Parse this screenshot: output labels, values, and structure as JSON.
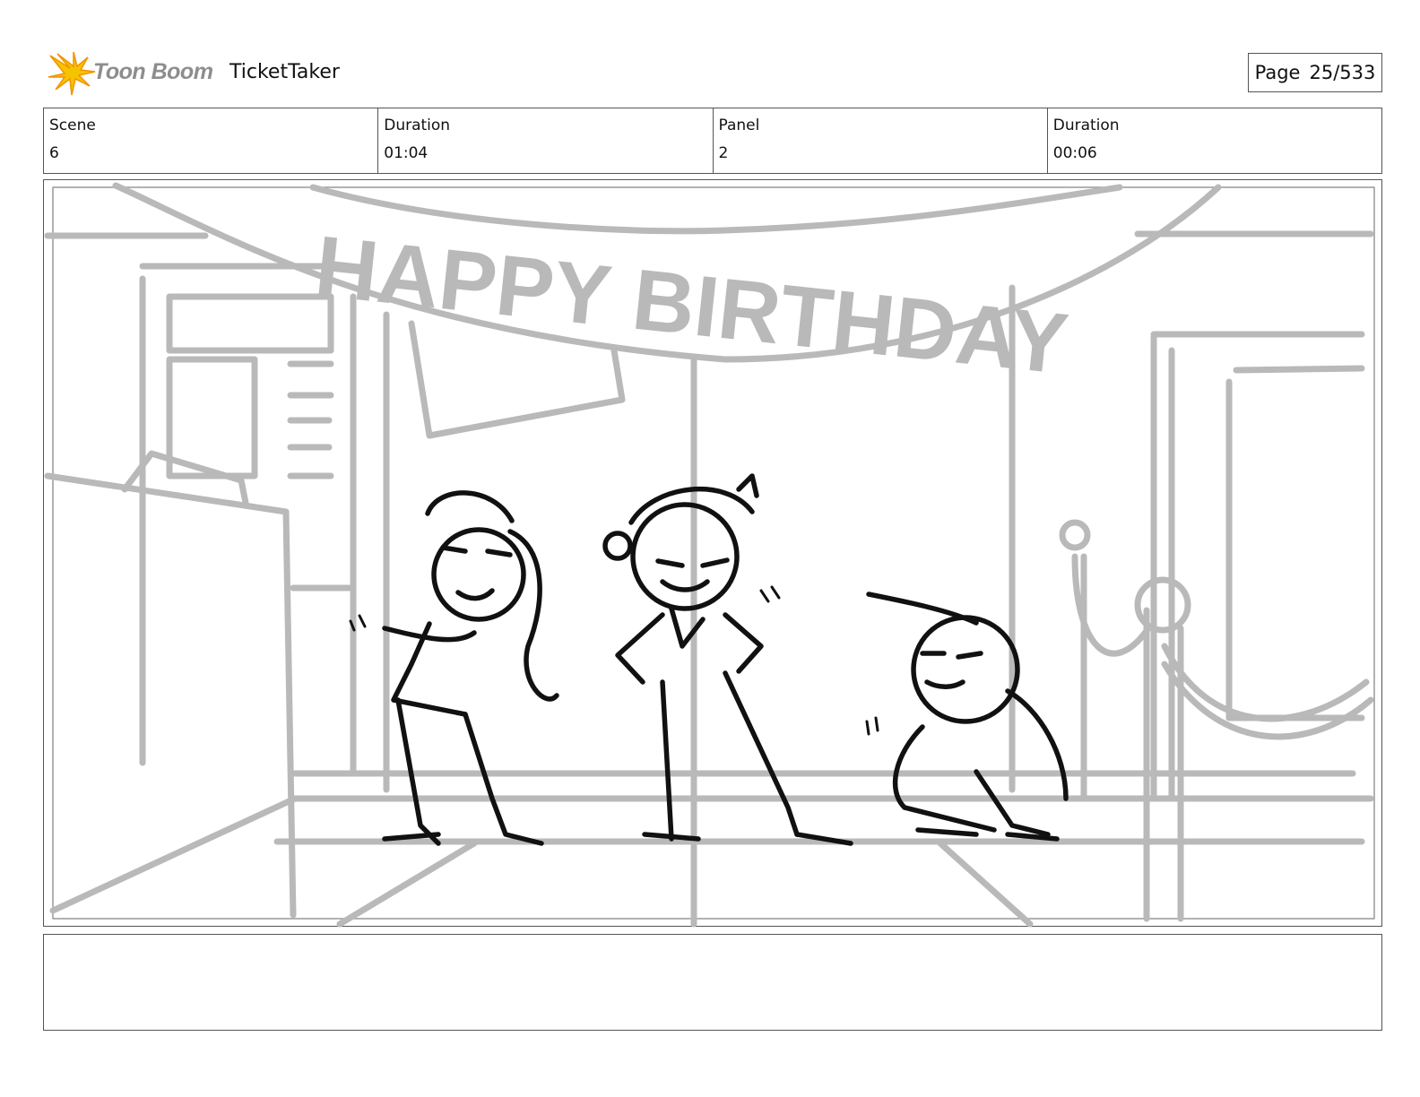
{
  "header": {
    "brand": "Toon Boom",
    "project": "TicketTaker",
    "page_label": "Page",
    "page_value": "25/533"
  },
  "info": {
    "scene_label": "Scene",
    "scene_value": "6",
    "scene_duration_label": "Duration",
    "scene_duration_value": "01:04",
    "panel_label": "Panel",
    "panel_value": "2",
    "panel_duration_label": "Duration",
    "panel_duration_value": "00:06"
  },
  "panel": {
    "banner_text": "HAPPY BIRTHDAY"
  },
  "colors": {
    "logo_yellow": "#f5c400",
    "logo_orange": "#f39200",
    "logo_text": "#8d8d8d",
    "sketch_gray": "#b9b9b9",
    "ink": "#111111"
  }
}
